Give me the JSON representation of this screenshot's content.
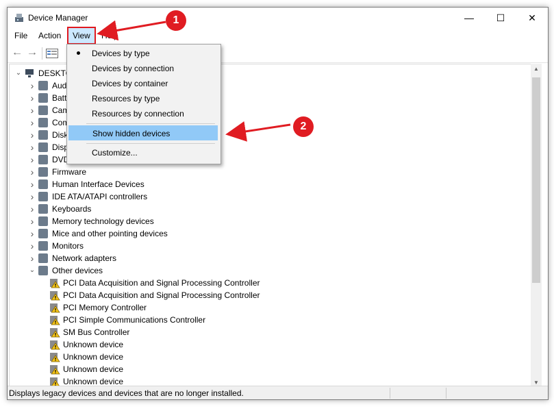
{
  "window": {
    "title": "Device Manager",
    "minimize_glyph": "—",
    "maximize_glyph": "☐",
    "close_glyph": "✕"
  },
  "menu": {
    "file": "File",
    "action": "Action",
    "view": "View",
    "help": "Help"
  },
  "view_menu": {
    "items": [
      "Devices by type",
      "Devices by connection",
      "Devices by container",
      "Resources by type",
      "Resources by connection",
      "Show hidden devices",
      "Customize..."
    ]
  },
  "tree": {
    "root": "DESKTO",
    "categories": [
      "Aud",
      "Batt",
      "Cam",
      "Com",
      "Disk",
      "Disp",
      "DVD",
      "Firmware",
      "Human Interface Devices",
      "IDE ATA/ATAPI controllers",
      "Keyboards",
      "Memory technology devices",
      "Mice and other pointing devices",
      "Monitors",
      "Network adapters",
      "Other devices"
    ],
    "other_devices": [
      "PCI Data Acquisition and Signal Processing Controller",
      "PCI Data Acquisition and Signal Processing Controller",
      "PCI Memory Controller",
      "PCI Simple Communications Controller",
      "SM Bus Controller",
      "Unknown device",
      "Unknown device",
      "Unknown device",
      "Unknown device"
    ]
  },
  "status": {
    "text": "Displays legacy devices and devices that are no longer installed."
  },
  "annotations": {
    "badge_1": "1",
    "badge_2": "2",
    "color": "#e01c22"
  }
}
